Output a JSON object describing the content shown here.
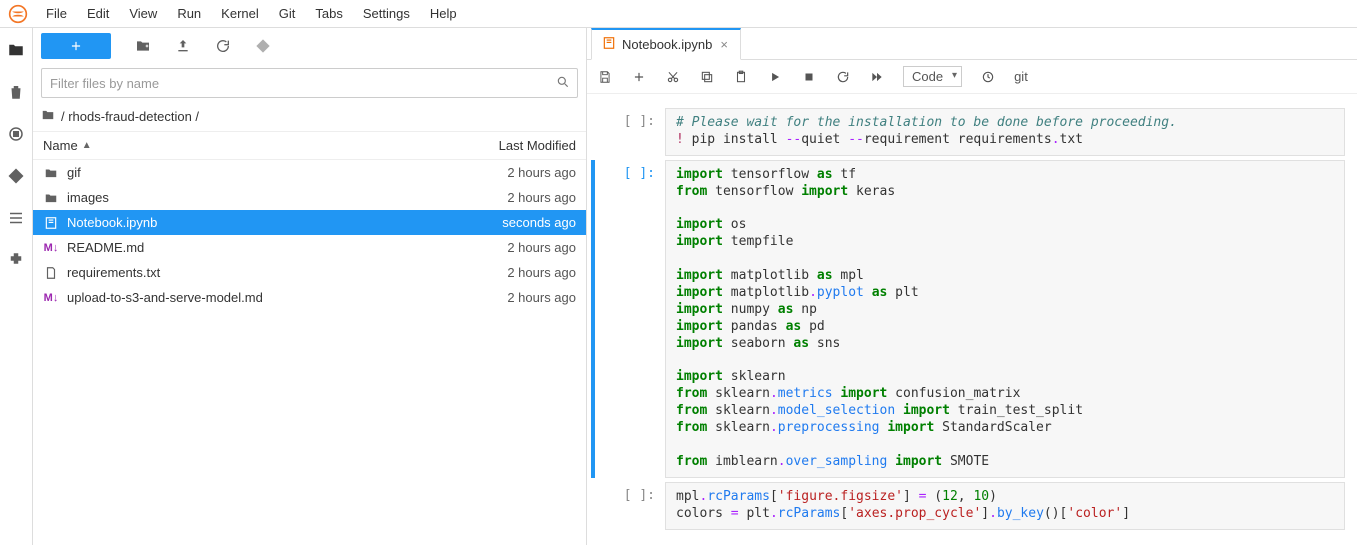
{
  "menu": {
    "items": [
      "File",
      "Edit",
      "View",
      "Run",
      "Kernel",
      "Git",
      "Tabs",
      "Settings",
      "Help"
    ]
  },
  "sidebar": {
    "filter_placeholder": "Filter files by name",
    "breadcrumb_path": "/ rhods-fraud-detection /",
    "columns": {
      "name": "Name",
      "modified": "Last Modified"
    },
    "files": [
      {
        "kind": "folder",
        "name": "gif",
        "time": "2 hours ago"
      },
      {
        "kind": "folder",
        "name": "images",
        "time": "2 hours ago"
      },
      {
        "kind": "notebook",
        "name": "Notebook.ipynb",
        "time": "seconds ago",
        "selected": true
      },
      {
        "kind": "markdown",
        "name": "README.md",
        "time": "2 hours ago"
      },
      {
        "kind": "file",
        "name": "requirements.txt",
        "time": "2 hours ago"
      },
      {
        "kind": "markdown",
        "name": "upload-to-s3-and-serve-model.md",
        "time": "2 hours ago"
      }
    ]
  },
  "tab": {
    "title": "Notebook.ipynb"
  },
  "nb_toolbar": {
    "cell_type": "Code",
    "git_label": "git"
  },
  "prompts": {
    "idle": "[ ]:",
    "active": "[ ]:"
  },
  "cells": [
    {
      "active": false,
      "tokens": [
        {
          "c": "cm",
          "t": "# Please wait for the installation to be done before proceeding."
        },
        {
          "t": "\n"
        },
        {
          "c": "mag",
          "t": "! "
        },
        {
          "t": "pip install "
        },
        {
          "c": "op",
          "t": "--"
        },
        {
          "t": "quiet "
        },
        {
          "c": "op",
          "t": "--"
        },
        {
          "t": "requirement requirements"
        },
        {
          "c": "op",
          "t": "."
        },
        {
          "t": "txt"
        }
      ]
    },
    {
      "active": true,
      "tokens": [
        {
          "c": "kw",
          "t": "import"
        },
        {
          "t": " tensorflow "
        },
        {
          "c": "kw",
          "t": "as"
        },
        {
          "t": " tf\n"
        },
        {
          "c": "kw",
          "t": "from"
        },
        {
          "t": " tensorflow "
        },
        {
          "c": "kw",
          "t": "import"
        },
        {
          "t": " keras\n"
        },
        {
          "t": "\n"
        },
        {
          "c": "kw",
          "t": "import"
        },
        {
          "t": " os\n"
        },
        {
          "c": "kw",
          "t": "import"
        },
        {
          "t": " tempfile\n"
        },
        {
          "t": "\n"
        },
        {
          "c": "kw",
          "t": "import"
        },
        {
          "t": " matplotlib "
        },
        {
          "c": "kw",
          "t": "as"
        },
        {
          "t": " mpl\n"
        },
        {
          "c": "kw",
          "t": "import"
        },
        {
          "t": " matplotlib"
        },
        {
          "c": "op",
          "t": "."
        },
        {
          "c": "attr",
          "t": "pyplot"
        },
        {
          "t": " "
        },
        {
          "c": "kw",
          "t": "as"
        },
        {
          "t": " plt\n"
        },
        {
          "c": "kw",
          "t": "import"
        },
        {
          "t": " numpy "
        },
        {
          "c": "kw",
          "t": "as"
        },
        {
          "t": " np\n"
        },
        {
          "c": "kw",
          "t": "import"
        },
        {
          "t": " pandas "
        },
        {
          "c": "kw",
          "t": "as"
        },
        {
          "t": " pd\n"
        },
        {
          "c": "kw",
          "t": "import"
        },
        {
          "t": " seaborn "
        },
        {
          "c": "kw",
          "t": "as"
        },
        {
          "t": " sns\n"
        },
        {
          "t": "\n"
        },
        {
          "c": "kw",
          "t": "import"
        },
        {
          "t": " sklearn\n"
        },
        {
          "c": "kw",
          "t": "from"
        },
        {
          "t": " sklearn"
        },
        {
          "c": "op",
          "t": "."
        },
        {
          "c": "attr",
          "t": "metrics"
        },
        {
          "t": " "
        },
        {
          "c": "kw",
          "t": "import"
        },
        {
          "t": " confusion_matrix\n"
        },
        {
          "c": "kw",
          "t": "from"
        },
        {
          "t": " sklearn"
        },
        {
          "c": "op",
          "t": "."
        },
        {
          "c": "attr",
          "t": "model_selection"
        },
        {
          "t": " "
        },
        {
          "c": "kw",
          "t": "import"
        },
        {
          "t": " train_test_split\n"
        },
        {
          "c": "kw",
          "t": "from"
        },
        {
          "t": " sklearn"
        },
        {
          "c": "op",
          "t": "."
        },
        {
          "c": "attr",
          "t": "preprocessing"
        },
        {
          "t": " "
        },
        {
          "c": "kw",
          "t": "import"
        },
        {
          "t": " StandardScaler\n"
        },
        {
          "t": "\n"
        },
        {
          "c": "kw",
          "t": "from"
        },
        {
          "t": " imblearn"
        },
        {
          "c": "op",
          "t": "."
        },
        {
          "c": "attr",
          "t": "over_sampling"
        },
        {
          "t": " "
        },
        {
          "c": "kw",
          "t": "import"
        },
        {
          "t": " SMOTE"
        }
      ]
    },
    {
      "active": false,
      "tokens": [
        {
          "t": "mpl"
        },
        {
          "c": "op",
          "t": "."
        },
        {
          "c": "attr",
          "t": "rcParams"
        },
        {
          "t": "["
        },
        {
          "c": "str",
          "t": "'figure.figsize'"
        },
        {
          "t": "] "
        },
        {
          "c": "op",
          "t": "="
        },
        {
          "t": " ("
        },
        {
          "c": "num",
          "t": "12"
        },
        {
          "t": ", "
        },
        {
          "c": "num",
          "t": "10"
        },
        {
          "t": ")\n"
        },
        {
          "t": "colors "
        },
        {
          "c": "op",
          "t": "="
        },
        {
          "t": " plt"
        },
        {
          "c": "op",
          "t": "."
        },
        {
          "c": "attr",
          "t": "rcParams"
        },
        {
          "t": "["
        },
        {
          "c": "str",
          "t": "'axes.prop_cycle'"
        },
        {
          "t": "]"
        },
        {
          "c": "op",
          "t": "."
        },
        {
          "c": "attr",
          "t": "by_key"
        },
        {
          "t": "()["
        },
        {
          "c": "str",
          "t": "'color'"
        },
        {
          "t": "]"
        }
      ]
    }
  ]
}
